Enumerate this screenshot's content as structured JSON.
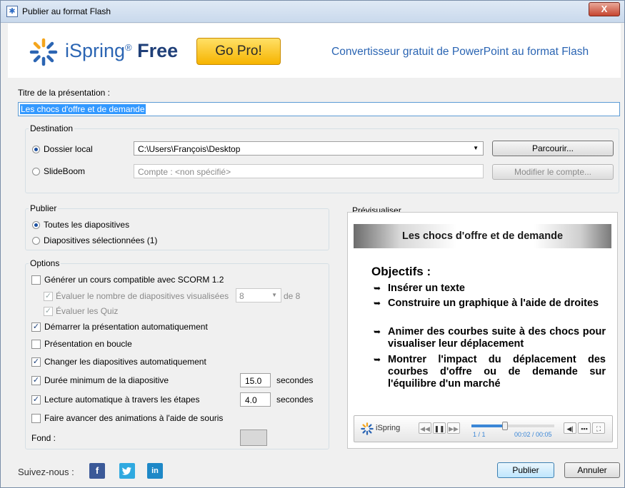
{
  "window": {
    "title": "Publier au format Flash",
    "close_glyph": "X"
  },
  "banner": {
    "brand": "iSpring",
    "reg_mark": "®",
    "edition": "Free",
    "go_pro": "Go Pro!",
    "tagline": "Convertisseur gratuit de PowerPoint au format Flash"
  },
  "title_section": {
    "label": "Titre de la présentation :",
    "value": "Les chocs d'offre et de demande"
  },
  "destination": {
    "legend": "Destination",
    "local_label": "Dossier local",
    "local_path": "C:\\Users\\François\\Desktop",
    "browse_button": "Parcourir...",
    "slideboom_label": "SlideBoom",
    "account_placeholder": "Compte : <non spécifié>",
    "modify_account_button": "Modifier le compte..."
  },
  "publish": {
    "legend": "Publier",
    "all_slides": "Toutes les diapositives",
    "selected_slides": "Diapositives sélectionnées (1)"
  },
  "options": {
    "legend": "Options",
    "scorm": "Générer un cours compatible avec SCORM 1.2",
    "eval_slides": "Évaluer le nombre de diapositives visualisées",
    "eval_slides_value": "8",
    "eval_slides_of": "de 8",
    "eval_quiz": "Évaluer les Quiz",
    "autostart": "Démarrer la présentation automatiquement",
    "loop": "Présentation en boucle",
    "auto_advance": "Changer les diapositives automatiquement",
    "min_duration": "Durée minimum de la diapositive",
    "min_duration_value": "15.0",
    "auto_steps": "Lecture automatique à travers les étapes",
    "auto_steps_value": "4.0",
    "seconds": "secondes",
    "mouse_anim": "Faire avancer des animations à l'aide de souris",
    "background": "Fond :"
  },
  "preview": {
    "legend": "Prévisualiser",
    "slide_title": "Les chocs d'offre et de demande",
    "objectives": "Objectifs :",
    "bullets": [
      "Insérer un texte",
      "Construire un graphique à l'aide de droites",
      "Animer des courbes suite à des chocs pour visualiser leur déplacement",
      "Montrer l'impact du déplacement des courbes d'offre ou de demande sur l'équilibre d'un marché"
    ],
    "player": {
      "brand": "iSpring",
      "page": "1 / 1",
      "time": "00:02 / 00:05",
      "progress": 0.4
    }
  },
  "footer": {
    "follow": "Suivez-nous :",
    "facebook": "f",
    "linkedin": "in",
    "publish_button": "Publier",
    "cancel_button": "Annuler"
  },
  "colors": {
    "brand_blue": "#2b65b3",
    "gopro_yellow": "#f6b400",
    "facebook": "#3b5998",
    "twitter": "#2fa9e0",
    "linkedin": "#1e88c7",
    "selection": "#3399ff"
  }
}
